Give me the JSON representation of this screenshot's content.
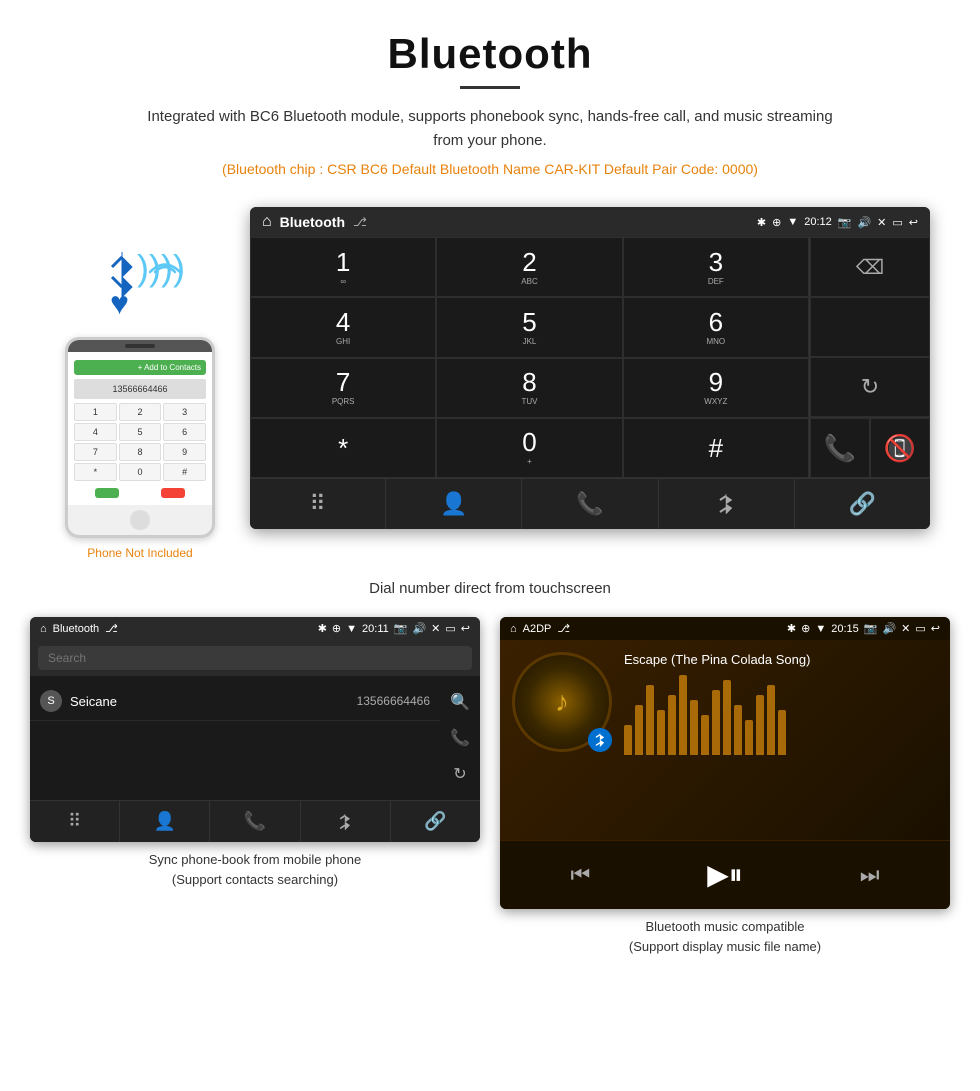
{
  "page": {
    "title": "Bluetooth",
    "description": "Integrated with BC6 Bluetooth module, supports phonebook sync, hands-free call, and music streaming from your phone.",
    "specs_line": "(Bluetooth chip : CSR BC6    Default Bluetooth Name CAR-KIT    Default Pair Code: 0000)",
    "dial_caption": "Dial number direct from touchscreen",
    "phone_not_included": "Phone Not Included"
  },
  "car_screen": {
    "title": "Bluetooth",
    "time": "20:12",
    "usb_icon": "⎇",
    "keys": [
      {
        "number": "1",
        "sub": "∞"
      },
      {
        "number": "2",
        "sub": "ABC"
      },
      {
        "number": "3",
        "sub": "DEF"
      },
      {
        "number": "4",
        "sub": "GHI"
      },
      {
        "number": "5",
        "sub": "JKL"
      },
      {
        "number": "6",
        "sub": "MNO"
      },
      {
        "number": "7",
        "sub": "PQRS"
      },
      {
        "number": "8",
        "sub": "TUV"
      },
      {
        "number": "9",
        "sub": "WXYZ"
      },
      {
        "number": "*",
        "sub": ""
      },
      {
        "number": "0",
        "sub": "+"
      },
      {
        "number": "#",
        "sub": ""
      }
    ],
    "nav_icons": [
      "⠿",
      "👤",
      "📞",
      "✱",
      "🔗"
    ]
  },
  "phonebook_screen": {
    "title": "Bluetooth",
    "time": "20:11",
    "search_placeholder": "Search",
    "contact": {
      "letter": "S",
      "name": "Seicane",
      "number": "13566664466"
    },
    "nav_icons": [
      "⠿",
      "👤",
      "📞",
      "✱",
      "🔗"
    ]
  },
  "music_screen": {
    "title": "A2DP",
    "time": "20:15",
    "song_title": "Escape (The Pina Colada Song)",
    "visualizer_bars": [
      30,
      50,
      70,
      45,
      60,
      80,
      55,
      40,
      65,
      75,
      50,
      35,
      60,
      70,
      45
    ],
    "controls": [
      "⏮",
      "⏭|",
      "⏭"
    ]
  },
  "bottom_captions": {
    "phonebook": "Sync phone-book from mobile phone\n(Support contacts searching)",
    "music": "Bluetooth music compatible\n(Support display music file name)"
  }
}
